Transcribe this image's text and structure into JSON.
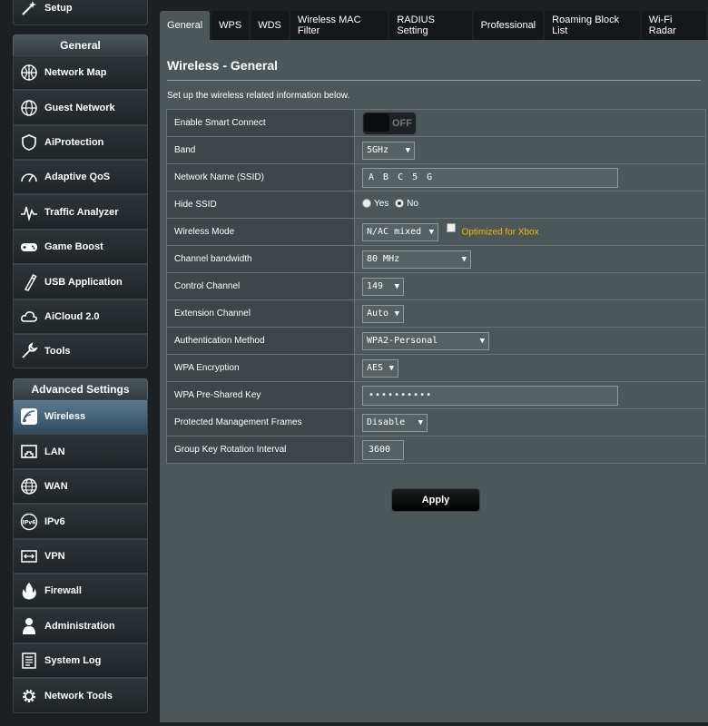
{
  "sidebar": {
    "setup_label": "Setup",
    "general_header": "General",
    "general_items": [
      {
        "label": "Network Map",
        "icon": "network-map-icon"
      },
      {
        "label": "Guest Network",
        "icon": "globe-icon"
      },
      {
        "label": "AiProtection",
        "icon": "shield-icon"
      },
      {
        "label": "Adaptive QoS",
        "icon": "gauge-icon"
      },
      {
        "label": "Traffic Analyzer",
        "icon": "pulse-icon"
      },
      {
        "label": "Game Boost",
        "icon": "gamepad-icon"
      },
      {
        "label": "USB Application",
        "icon": "usb-icon"
      },
      {
        "label": "AiCloud 2.0",
        "icon": "cloud-icon"
      },
      {
        "label": "Tools",
        "icon": "wrench-icon"
      }
    ],
    "advanced_header": "Advanced Settings",
    "advanced_items": [
      {
        "label": "Wireless",
        "icon": "wifi-icon",
        "active": true
      },
      {
        "label": "LAN",
        "icon": "lan-icon"
      },
      {
        "label": "WAN",
        "icon": "globe-icon"
      },
      {
        "label": "IPv6",
        "icon": "ipv6-icon"
      },
      {
        "label": "VPN",
        "icon": "vpn-icon"
      },
      {
        "label": "Firewall",
        "icon": "fire-icon"
      },
      {
        "label": "Administration",
        "icon": "person-icon"
      },
      {
        "label": "System Log",
        "icon": "log-icon"
      },
      {
        "label": "Network Tools",
        "icon": "gear-icon"
      }
    ]
  },
  "tabs": [
    "General",
    "WPS",
    "WDS",
    "Wireless MAC Filter",
    "RADIUS Setting",
    "Professional",
    "Roaming Block List",
    "Wi-Fi Radar"
  ],
  "active_tab": 0,
  "page": {
    "title": "Wireless - General",
    "description": "Set up the wireless related information below."
  },
  "form": {
    "smart_connect_label": "Enable Smart Connect",
    "smart_connect_state": "OFF",
    "band_label": "Band",
    "band_value": "5GHz",
    "ssid_label": "Network Name (SSID)",
    "ssid_value": "A B C 5 G",
    "hide_ssid_label": "Hide SSID",
    "hide_ssid_yes": "Yes",
    "hide_ssid_no": "No",
    "wireless_mode_label": "Wireless Mode",
    "wireless_mode_value": "N/AC mixed",
    "xbox_label": "Optimized for Xbox",
    "channel_bw_label": "Channel bandwidth",
    "channel_bw_value": "80 MHz",
    "control_channel_label": "Control Channel",
    "control_channel_value": "149",
    "extension_channel_label": "Extension Channel",
    "extension_channel_value": "Auto",
    "auth_method_label": "Authentication Method",
    "auth_method_value": "WPA2-Personal",
    "wpa_enc_label": "WPA Encryption",
    "wpa_enc_value": "AES",
    "psk_label": "WPA Pre-Shared Key",
    "psk_value": "••••••••••",
    "pmf_label": "Protected Management Frames",
    "pmf_value": "Disable",
    "gkri_label": "Group Key Rotation Interval",
    "gkri_value": "3600"
  },
  "apply_label": "Apply",
  "colors": {
    "main_bg": "#4d5659",
    "active_nav": "#3f5f78",
    "xbox_text": "#f5b800"
  }
}
